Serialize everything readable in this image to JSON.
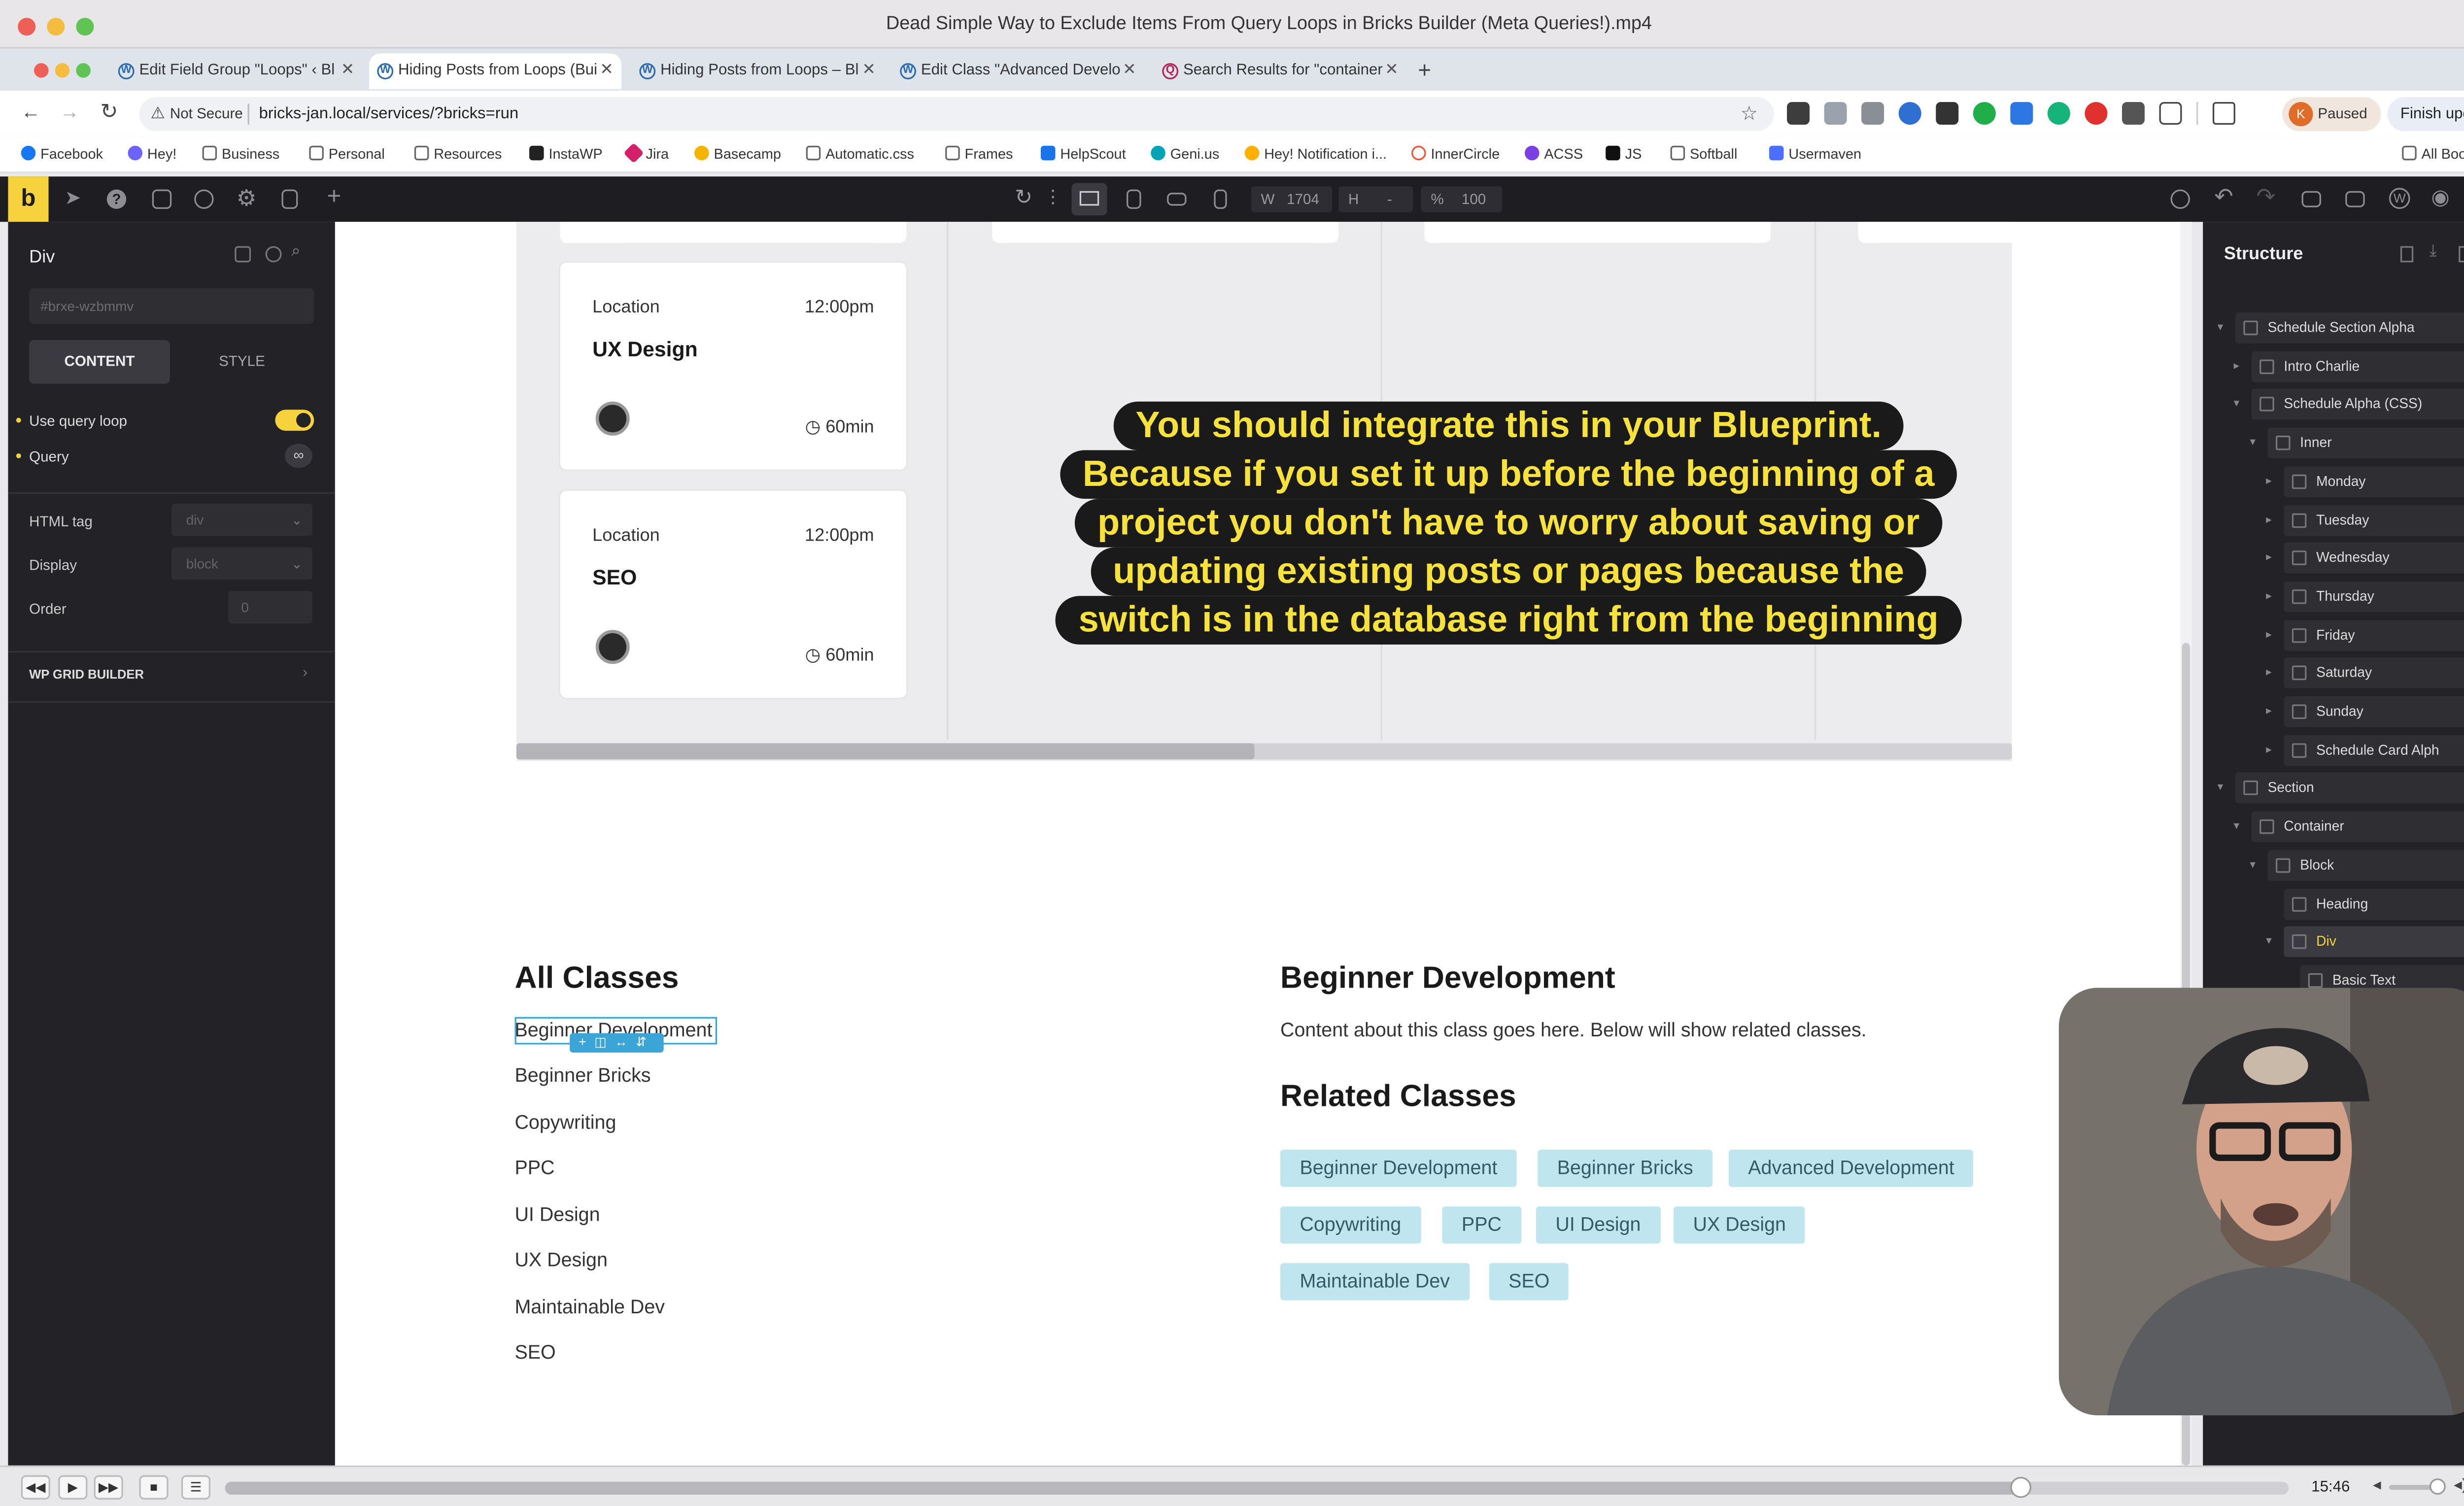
{
  "window": {
    "title": "Dead Simple Way to Exclude Items From Query Loops in Bricks Builder (Meta Queries!).mp4"
  },
  "tabs": [
    {
      "label": "Edit Field Group \"Loops\" ‹ Bl",
      "active": false
    },
    {
      "label": "Hiding Posts from Loops (Bui",
      "active": true
    },
    {
      "label": "Hiding Posts from Loops – Bl",
      "active": false
    },
    {
      "label": "Edit Class \"Advanced Develo",
      "active": false
    },
    {
      "label": "Search Results for \"container",
      "active": false
    }
  ],
  "address": {
    "security": "Not Secure",
    "url": "bricks-jan.local/services/?bricks=run"
  },
  "profile": {
    "initial": "K",
    "status": "Paused",
    "update_label": "Finish update"
  },
  "bookmarks": [
    "Facebook",
    "Hey!",
    "Business",
    "Personal",
    "Resources",
    "InstaWP",
    "Jira",
    "Basecamp",
    "Automatic.css",
    "Frames",
    "HelpScout",
    "Geni.us",
    "Hey! Notification i...",
    "InnerCircle",
    "ACSS",
    "JS",
    "Softball",
    "Usermaven"
  ],
  "all_bookmarks": "All Bookmarks",
  "builder": {
    "logo": "b",
    "width_label": "W",
    "width_value": "1704",
    "height_label": "H",
    "height_value": "-",
    "zoom_label": "%",
    "zoom_value": "100"
  },
  "left_panel": {
    "element": "Div",
    "id_placeholder": "#brxe-wzbmmv",
    "tab_content": "CONTENT",
    "tab_style": "STYLE",
    "use_query_loop": "Use query loop",
    "query_loop_on": true,
    "query": "Query",
    "html_tag_label": "HTML tag",
    "html_tag_value": "div",
    "display_label": "Display",
    "display_value": "block",
    "order_label": "Order",
    "order_value": "0",
    "grid_builder": "WP GRID BUILDER"
  },
  "cards": [
    {
      "location": "Location",
      "time": "12:00pm",
      "title": "UX Design",
      "duration": "60min"
    },
    {
      "location": "Location",
      "time": "12:00pm",
      "title": "SEO",
      "duration": "60min"
    }
  ],
  "caption": [
    "You should integrate this in your Blueprint.",
    "Because if you set it up before the beginning of a",
    "project you don't have to worry about saving or",
    "updating existing posts or pages because the",
    "switch is in the database right from the beginning"
  ],
  "all_classes": {
    "heading": "All Classes",
    "items": [
      "Beginner Development",
      "Beginner Bricks",
      "Copywriting",
      "PPC",
      "UI Design",
      "UX Design",
      "Maintainable Dev",
      "SEO"
    ]
  },
  "detail": {
    "heading": "Beginner Development",
    "body": "Content about this class goes here. Below will show related classes.",
    "related_heading": "Related Classes",
    "tags": [
      "Beginner Development",
      "Beginner Bricks",
      "Advanced Development",
      "Copywriting",
      "PPC",
      "UI Design",
      "UX Design",
      "Maintainable Dev",
      "SEO"
    ]
  },
  "structure": {
    "title": "Structure",
    "rows": [
      {
        "label": "Schedule Section Alpha",
        "depth": 0,
        "caret": "open"
      },
      {
        "label": "Intro Charlie",
        "depth": 1,
        "caret": "closed"
      },
      {
        "label": "Schedule Alpha (CSS)",
        "depth": 1,
        "caret": "open"
      },
      {
        "label": "Inner",
        "depth": 2,
        "caret": "open"
      },
      {
        "label": "Monday",
        "depth": 3,
        "caret": "closed"
      },
      {
        "label": "Tuesday",
        "depth": 3,
        "caret": "closed"
      },
      {
        "label": "Wednesday",
        "depth": 3,
        "caret": "closed"
      },
      {
        "label": "Thursday",
        "depth": 3,
        "caret": "closed"
      },
      {
        "label": "Friday",
        "depth": 3,
        "caret": "closed"
      },
      {
        "label": "Saturday",
        "depth": 3,
        "caret": "closed"
      },
      {
        "label": "Sunday",
        "depth": 3,
        "caret": "closed"
      },
      {
        "label": "Schedule Card Alph",
        "depth": 3,
        "caret": "closed"
      },
      {
        "label": "Section",
        "depth": 0,
        "caret": "open"
      },
      {
        "label": "Container",
        "depth": 1,
        "caret": "open"
      },
      {
        "label": "Block",
        "depth": 2,
        "caret": "open"
      },
      {
        "label": "Heading",
        "depth": 3,
        "caret": "none"
      },
      {
        "label": "Div",
        "depth": 3,
        "caret": "open",
        "selected": true
      },
      {
        "label": "Basic Text",
        "depth": 4,
        "caret": "none"
      }
    ]
  },
  "player": {
    "time": "15:46",
    "progress": 0.87,
    "volume": 0.85
  },
  "colors": {
    "accent": "#f6d33c",
    "tag_bg": "#bfe6ef",
    "caption_text": "#f6e23a",
    "panel_bg": "#232327"
  }
}
